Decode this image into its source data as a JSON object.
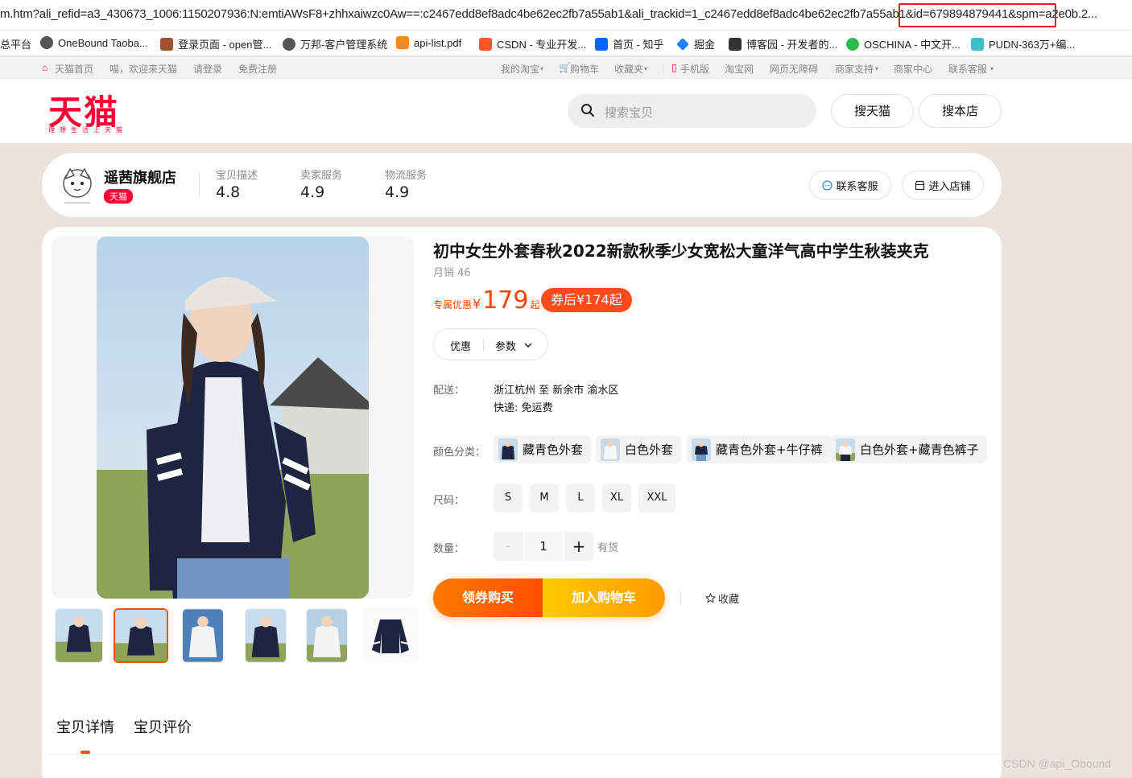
{
  "browser": {
    "url": "m.htm?ali_refid=a3_430673_1006:1150207936:N:emtiAWsF8+zhhxaiwzc0Aw==:c2467edd8ef8adc4be62ec2fb7a55ab1&ali_trackid=1_c2467edd8ef8adc4be62ec2fb7a55ab1&id=679894879441&spm=a2e0b.2..."
  },
  "bookmarks": [
    {
      "label": "总平台",
      "icon": "folder-icon"
    },
    {
      "label": "OneBound Taoba...",
      "icon": "globe-icon"
    },
    {
      "label": "登录页面 - open管...",
      "icon": "page-icon"
    },
    {
      "label": "万邦-客户管理系统",
      "icon": "globe-icon"
    },
    {
      "label": "api-list.pdf",
      "icon": "pdf-icon"
    },
    {
      "label": "CSDN - 专业开发...",
      "icon": "csdn-icon"
    },
    {
      "label": "首页 - 知乎",
      "icon": "zhihu-icon"
    },
    {
      "label": "掘金",
      "icon": "juejin-icon"
    },
    {
      "label": "博客园 - 开发者的...",
      "icon": "cnblogs-icon"
    },
    {
      "label": "OSCHINA - 中文开...",
      "icon": "oschina-icon"
    },
    {
      "label": "PUDN-363万+编...",
      "icon": "pudn-icon"
    }
  ],
  "site_nav": {
    "left": [
      "天猫首页",
      "喵，欢迎来天猫",
      "请登录",
      "免费注册"
    ],
    "right": [
      "我的淘宝",
      "购物车",
      "收藏夹",
      "手机版",
      "淘宝网",
      "网页无障碍",
      "商家支持",
      "商家中心",
      "联系客服"
    ]
  },
  "header": {
    "logo": "天猫",
    "slogan": "理想生活上天猫",
    "search_placeholder": "搜索宝贝",
    "search_tmall": "搜天猫",
    "search_shop": "搜本店"
  },
  "shop": {
    "name": "遥茜旗舰店",
    "badge": "天猫",
    "ratings": [
      {
        "label": "宝贝描述",
        "value": "4.8"
      },
      {
        "label": "卖家服务",
        "value": "4.9"
      },
      {
        "label": "物流服务",
        "value": "4.9"
      }
    ],
    "contact": "联系客服",
    "enter_shop": "进入店铺"
  },
  "product": {
    "title": "初中女生外套春秋2022新款秋季少女宽松大童洋气高中学生秋装夹克",
    "sales": "月销 46",
    "price_label": "专属优惠",
    "currency": "¥",
    "price": "179",
    "price_suffix": "起",
    "coupon_price": "券后¥174起",
    "pill_tabs": [
      "优惠",
      "参数"
    ],
    "delivery_label": "配送：",
    "delivery_route": "浙江杭州 至 新余市 渝水区",
    "delivery_fee": "快递: 免运费",
    "color_label": "颜色分类：",
    "colors": [
      "藏青色外套",
      "白色外套",
      "藏青色外套+牛仔裤",
      "白色外套+藏青色裤子"
    ],
    "size_label": "尺码：",
    "sizes": [
      "S",
      "M",
      "L",
      "XL",
      "XXL"
    ],
    "qty_label": "数量：",
    "qty_minus": "-",
    "qty": "1",
    "qty_plus": "+",
    "stock": "有货",
    "buy_now": "领券购买",
    "add_cart": "加入购物车",
    "favorite": "收藏"
  },
  "detail_tabs": [
    "宝贝详情",
    "宝贝评价"
  ],
  "watermark": "CSDN @api_Obound",
  "colors": {
    "tmall_red": "#ff0036",
    "price_orange": "#ff4400",
    "highlight_red": "#e02020"
  }
}
